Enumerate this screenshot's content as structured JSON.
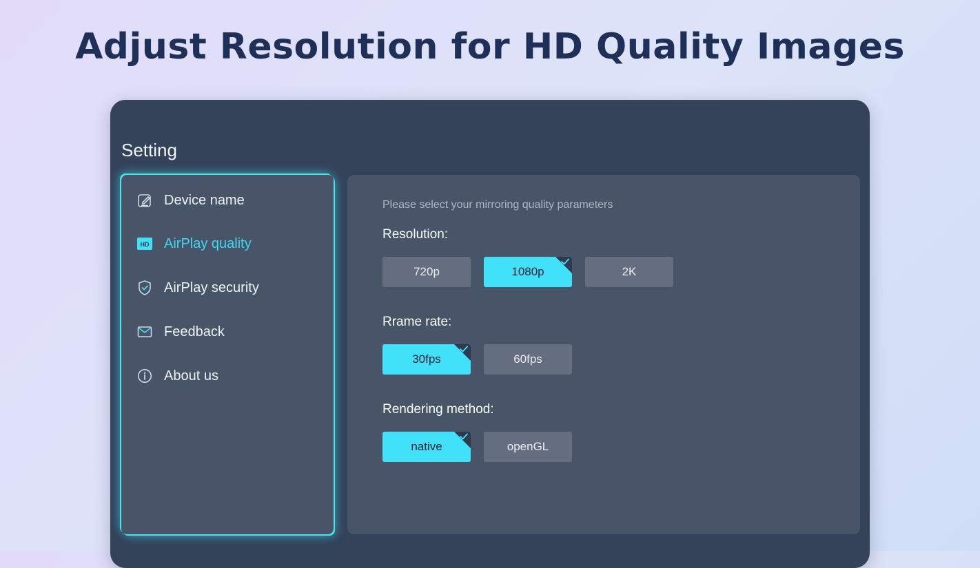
{
  "page": {
    "headline": "Adjust Resolution for HD Quality Images"
  },
  "window": {
    "title": "Setting"
  },
  "sidebar": {
    "items": [
      {
        "label": "Device name",
        "icon": "edit-icon",
        "active": false
      },
      {
        "label": "AirPlay quality",
        "icon": "hd-icon",
        "icon_text": "HD",
        "active": true
      },
      {
        "label": "AirPlay security",
        "icon": "shield-check-icon",
        "active": false
      },
      {
        "label": "Feedback",
        "icon": "mail-icon",
        "active": false
      },
      {
        "label": "About us",
        "icon": "info-icon",
        "active": false
      }
    ]
  },
  "main": {
    "hint": "Please select your mirroring quality parameters",
    "resolution": {
      "label": "Resolution:",
      "options": [
        "720p",
        "1080p",
        "2K"
      ],
      "selected": "1080p"
    },
    "frame_rate": {
      "label": "Rrame rate:",
      "options": [
        "30fps",
        "60fps"
      ],
      "selected": "30fps"
    },
    "rendering": {
      "label": "Rendering method:",
      "options": [
        "native",
        "openGL"
      ],
      "selected": "native"
    }
  },
  "colors": {
    "accent": "#42e1fa",
    "active_text": "#3fd8f2",
    "window_bg": "#34425a",
    "panel_bg": "#485569",
    "option_bg": "#646e80",
    "headline": "#1f3058"
  }
}
